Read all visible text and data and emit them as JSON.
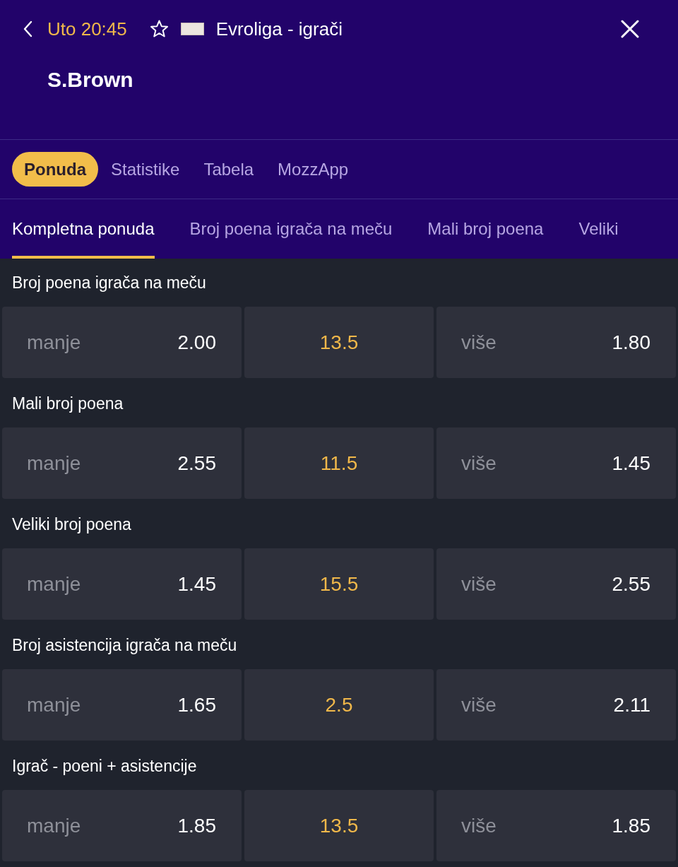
{
  "header": {
    "time": "Uto 20:45",
    "competition": "Evroliga - igrači",
    "player": "S.Brown"
  },
  "tabs": [
    {
      "label": "Ponuda",
      "selected": true
    },
    {
      "label": "Statistike",
      "selected": false
    },
    {
      "label": "Tabela",
      "selected": false
    },
    {
      "label": "MozzApp",
      "selected": false
    }
  ],
  "sub_tabs": [
    {
      "label": "Kompletna ponuda",
      "selected": true
    },
    {
      "label": "Broj poena igrača na meču",
      "selected": false
    },
    {
      "label": "Mali broj poena",
      "selected": false
    },
    {
      "label": "Veliki",
      "selected": false
    }
  ],
  "markets": [
    {
      "title": "Broj poena igrača na meču",
      "cells": [
        {
          "kind": "odd",
          "label": "manje",
          "odds": "2.00"
        },
        {
          "kind": "line",
          "value": "13.5"
        },
        {
          "kind": "odd",
          "label": "više",
          "odds": "1.80"
        }
      ]
    },
    {
      "title": "Mali broj poena",
      "cells": [
        {
          "kind": "odd",
          "label": "manje",
          "odds": "2.55"
        },
        {
          "kind": "line",
          "value": "11.5"
        },
        {
          "kind": "odd",
          "label": "više",
          "odds": "1.45"
        }
      ]
    },
    {
      "title": "Veliki broj poena",
      "cells": [
        {
          "kind": "odd",
          "label": "manje",
          "odds": "1.45"
        },
        {
          "kind": "line",
          "value": "15.5"
        },
        {
          "kind": "odd",
          "label": "više",
          "odds": "2.55"
        }
      ]
    },
    {
      "title": "Broj asistencija igrača na meču",
      "cells": [
        {
          "kind": "odd",
          "label": "manje",
          "odds": "1.65"
        },
        {
          "kind": "line",
          "value": "2.5"
        },
        {
          "kind": "odd",
          "label": "više",
          "odds": "2.11"
        }
      ]
    },
    {
      "title": "Igrač - poeni + asistencije",
      "cells": [
        {
          "kind": "odd",
          "label": "manje",
          "odds": "1.85"
        },
        {
          "kind": "line",
          "value": "13.5"
        },
        {
          "kind": "odd",
          "label": "više",
          "odds": "1.85"
        }
      ]
    }
  ]
}
